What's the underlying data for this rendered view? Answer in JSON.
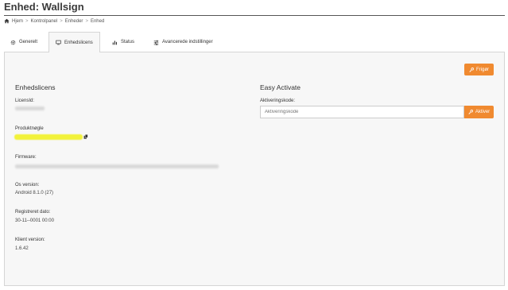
{
  "page": {
    "title": "Enhed: Wallsign"
  },
  "breadcrumb": {
    "home": "Hjem",
    "items": [
      "Kontrolpanel",
      "Enheder",
      "Enhed"
    ],
    "separator": ">"
  },
  "tabs": [
    {
      "label": "Generelt",
      "icon": "gear-icon"
    },
    {
      "label": "Enhedslicens",
      "icon": "monitor-icon",
      "active": true
    },
    {
      "label": "Status",
      "icon": "bar-chart-icon"
    },
    {
      "label": "Avancerede indstillinger",
      "icon": "sliders-icon"
    }
  ],
  "actions": {
    "release_label": "Frigør",
    "activate_label": "Aktiver"
  },
  "license": {
    "title": "Enhedslicens",
    "license_id_label": "LicensId:",
    "product_key_label": "Produktnøgle",
    "firmware_label": "Firmware:",
    "os_version_label": "Os version:",
    "os_version_value": "Android 8.1.0 (27)",
    "registered_label": "Registreret dato:",
    "registered_value": "30-11--0001 00:00",
    "client_version_label": "Klient version:",
    "client_version_value": "1.6.42"
  },
  "easy_activate": {
    "title": "Easy Activate",
    "code_label": "Aktiveringskode:",
    "code_placeholder": "Aktiveringskode",
    "code_value": ""
  },
  "colors": {
    "accent": "#f08a30",
    "panel_bg": "#f7f7f7",
    "highlight": "#f2f23a"
  }
}
